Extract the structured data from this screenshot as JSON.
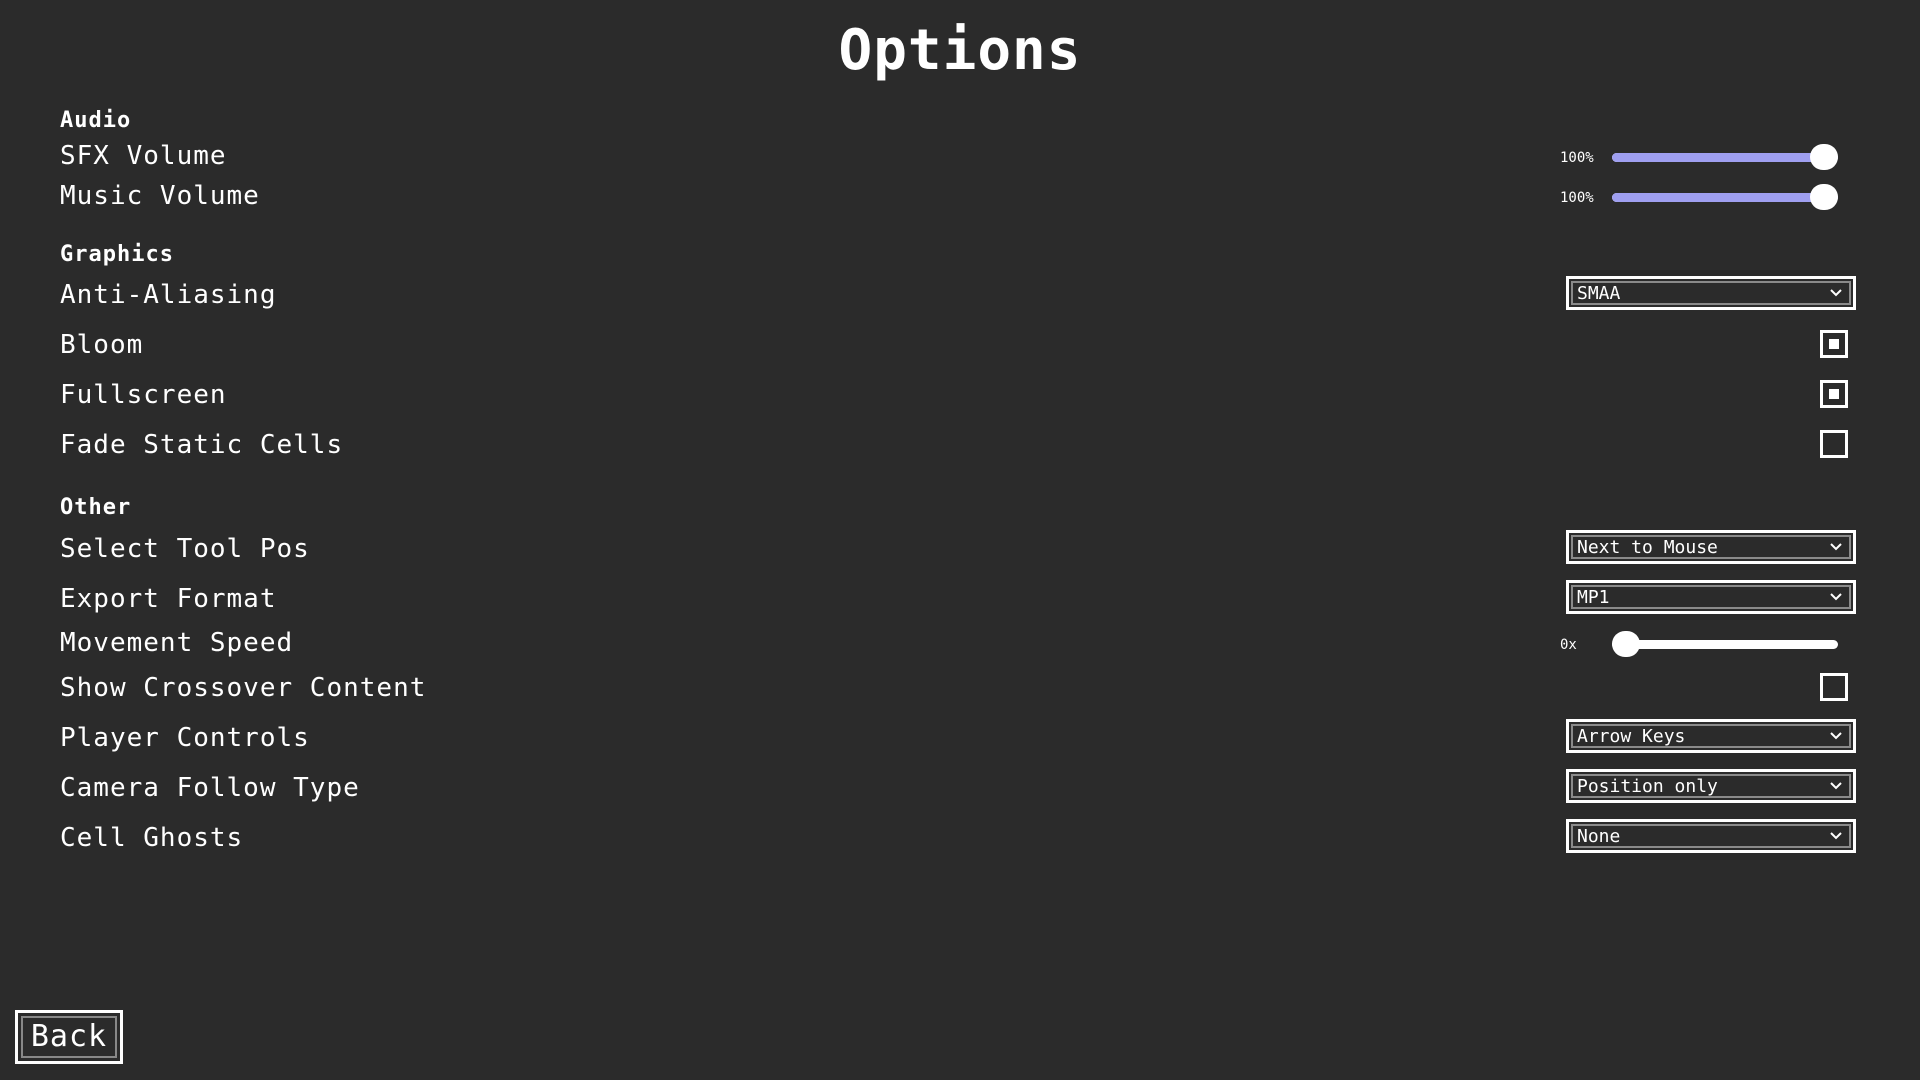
{
  "page": {
    "title": "Options"
  },
  "sections": {
    "audio": "Audio",
    "graphics": "Graphics",
    "other": "Other"
  },
  "settings": {
    "sfx_volume": {
      "label": "SFX Volume",
      "value_text": "100%",
      "value": 1.0
    },
    "music_volume": {
      "label": "Music Volume",
      "value_text": "100%",
      "value": 1.0
    },
    "anti_aliasing": {
      "label": "Anti-Aliasing",
      "selected": "SMAA"
    },
    "bloom": {
      "label": "Bloom",
      "checked": true
    },
    "fullscreen": {
      "label": "Fullscreen",
      "checked": true
    },
    "fade_static_cells": {
      "label": "Fade Static Cells",
      "checked": false
    },
    "select_tool_pos": {
      "label": "Select Tool Pos",
      "selected": "Next to Mouse"
    },
    "export_format": {
      "label": "Export Format",
      "selected": "MP1"
    },
    "movement_speed": {
      "label": "Movement Speed",
      "value_text": "0x",
      "value": 0.0
    },
    "show_crossover_content": {
      "label": "Show Crossover Content",
      "checked": false
    },
    "player_controls": {
      "label": "Player Controls",
      "selected": "Arrow Keys"
    },
    "camera_follow_type": {
      "label": "Camera Follow Type",
      "selected": "Position only"
    },
    "cell_ghosts": {
      "label": "Cell Ghosts",
      "selected": "None"
    }
  },
  "buttons": {
    "back": "Back"
  },
  "colors": {
    "background": "#2b2b2b",
    "slider_fill": "#9f9ff0",
    "foreground": "#ffffff"
  },
  "icons": {
    "dropdown": "chevron-down-icon"
  }
}
